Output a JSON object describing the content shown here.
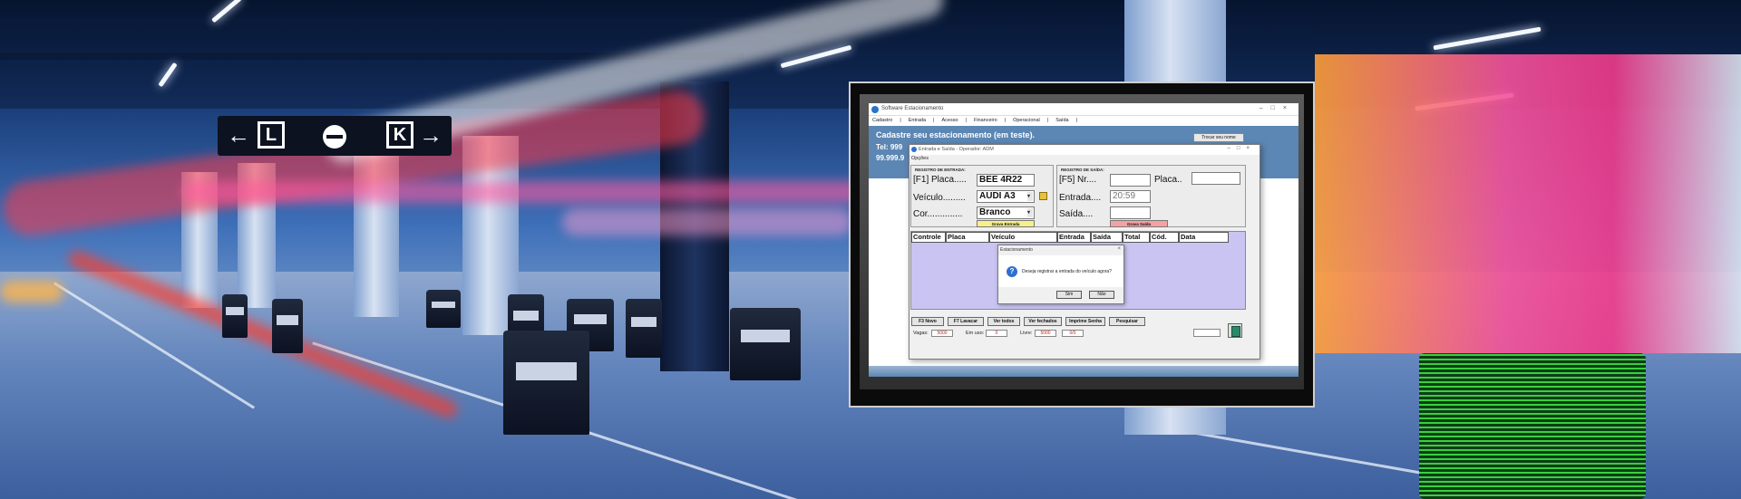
{
  "app": {
    "title": "Software Estacionamento",
    "menu": [
      "Cadastro",
      "|",
      "Entrada",
      "|",
      "Acesso",
      "|",
      "Financeiro",
      "|",
      "Operacional",
      "|",
      "Saída",
      "|"
    ],
    "banner_line1": "Cadastre seu  estacionamento (em teste).",
    "banner_line2": "Tel: 999",
    "banner_line3": "99.999.9",
    "banner_button": "Trocar seu nome"
  },
  "dialog": {
    "title": "Entrada e Saída - Operador: ADM",
    "opcoes": "Opções",
    "entry_group": {
      "title": "REGISTRO DE ENTRADA:",
      "placa_label": "[F1] Placa.....",
      "placa_value": "BEE 4R22",
      "veiculo_label": "Veículo.........",
      "veiculo_value": "AUDI  A3",
      "cor_label": "Cor..............",
      "cor_value": "Branco",
      "save_button": "Grava Entrada"
    },
    "exit_group": {
      "title": "REGISTRO DE SAÍDA:",
      "nr_label": "[F5] Nr....",
      "nr_value": "",
      "placa_label": "Placa..",
      "placa_value": "",
      "entrada_label": "Entrada....",
      "entrada_value": "20:59",
      "saida_label": "Saída....",
      "saida_value": "",
      "save_button": "Grava Saída"
    },
    "table_headers": [
      "Controle",
      "Placa",
      "Veículo",
      "Entrada",
      "Saída",
      "Total",
      "Cód.",
      "Data"
    ],
    "confirm": {
      "title": "Estacionamento",
      "close": "×",
      "message": "Deseja registrar a entrada do veículo agora?",
      "yes": "Sim",
      "no": "Não",
      "icon": "question-icon"
    },
    "buttons": [
      "F3 Novo",
      "F7 Lavacar",
      "Ver todos",
      "Ver fechados",
      "Imprime Senha",
      "Pesquisar"
    ],
    "status": {
      "vagas_label": "Vagas:",
      "vagas_value": "5000",
      "emuso_label": "Em uso:",
      "emuso_value": "0",
      "livre_label": "Livre:",
      "livre_value": "5000",
      "extra_value": "0/0"
    }
  },
  "colors": {
    "banner": "#5c86b3",
    "table_bg": "#c9c4f2",
    "save_entry": "#f7f08a",
    "save_exit": "#f6a1a1"
  }
}
